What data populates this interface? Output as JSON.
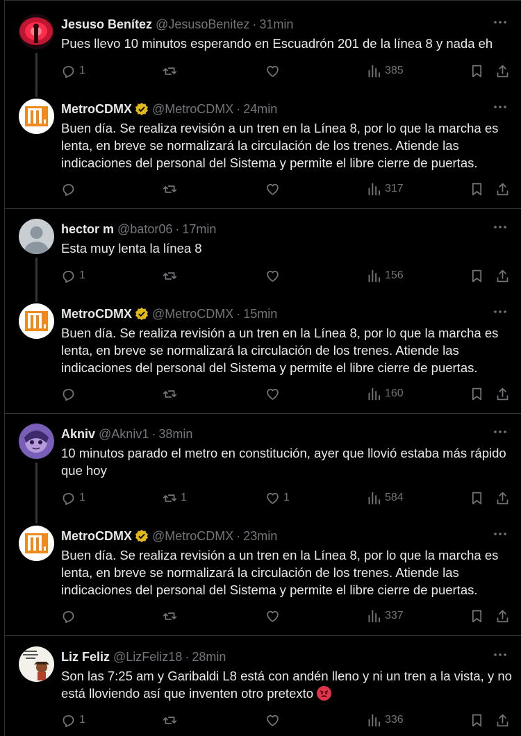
{
  "tweets": [
    {
      "name": "Jesuso Benítez",
      "handle": "@JesusoBenitez",
      "time": "31min",
      "text": "Pues llevo 10 minutos esperando en Escuadrón 201 de la línea 8 y nada eh",
      "replies": "1",
      "retweets": "",
      "likes": "",
      "views": "385"
    },
    {
      "name": "MetroCDMX",
      "handle": "@MetroCDMX",
      "time": "24min",
      "text": "Buen día. Se realiza revisión a un tren en la Línea 8, por lo que la marcha es lenta, en breve se normalizará la circulación de los trenes. Atiende las indicaciones del personal del Sistema y permite el libre cierre de puertas.",
      "replies": "",
      "retweets": "",
      "likes": "",
      "views": "317"
    },
    {
      "name": "hector m",
      "handle": "@bator06",
      "time": "17min",
      "text": "Esta muy lenta la línea 8",
      "replies": "1",
      "retweets": "",
      "likes": "",
      "views": "156"
    },
    {
      "name": "MetroCDMX",
      "handle": "@MetroCDMX",
      "time": "15min",
      "text": "Buen día. Se realiza revisión a un tren en la Línea 8, por lo que la marcha es lenta, en breve se normalizará la circulación de los trenes. Atiende las indicaciones del personal del Sistema y permite el libre cierre de puertas.",
      "replies": "",
      "retweets": "",
      "likes": "",
      "views": "160"
    },
    {
      "name": "Akniv",
      "handle": "@Akniv1",
      "time": "38min",
      "text": "10 minutos parado el metro en constitución, ayer que llovió estaba más rápido que hoy",
      "replies": "1",
      "retweets": "1",
      "likes": "1",
      "views": "584"
    },
    {
      "name": "MetroCDMX",
      "handle": "@MetroCDMX",
      "time": "23min",
      "text": "Buen día. Se realiza revisión a un tren en la Línea 8, por lo que la marcha es lenta, en breve se normalizará la circulación de los trenes. Atiende las indicaciones del personal del Sistema y permite el libre cierre de puertas.",
      "replies": "",
      "retweets": "",
      "likes": "",
      "views": "337"
    },
    {
      "name": "Liz Feliz",
      "handle": "@LizFeliz18",
      "time": "28min",
      "text": "Son las 7:25 am y Garibaldi L8 está con andén lleno y ni un tren a la vista, y no está lloviendo así que inventen otro pretexto",
      "emoji": "angry-face-emoji",
      "replies": "1",
      "retweets": "",
      "likes": "",
      "views": "336"
    }
  ],
  "separator": "·",
  "colors": {
    "background": "#000000",
    "text": "#e7e9ea",
    "muted": "#71767b",
    "border": "#2f3336",
    "verified_gold": "#e2b719",
    "metro_orange": "#f08a1c"
  },
  "icons": [
    "reply-icon",
    "retweet-icon",
    "like-icon",
    "views-icon",
    "bookmark-icon",
    "share-icon",
    "more-icon",
    "verified-badge-icon",
    "metro-logo"
  ]
}
